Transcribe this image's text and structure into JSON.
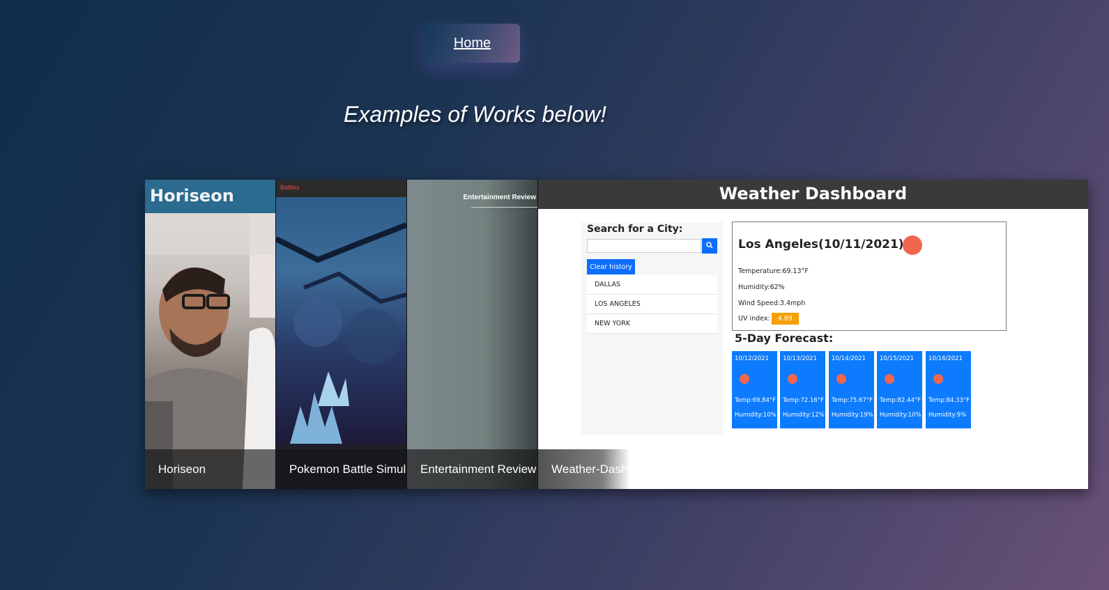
{
  "nav": {
    "home_label": "Home"
  },
  "headline": "Examples of Works below!",
  "works": [
    {
      "caption": "Horiseon",
      "brand": "Horiseon"
    },
    {
      "caption": "Pokemon Battle Simulat",
      "brand": "Battles"
    },
    {
      "caption": "Entertainment Review",
      "nav_title": "Entertainment Review"
    },
    {
      "caption": "Weather-Dashb"
    }
  ],
  "weather": {
    "title": "Weather Dashboard",
    "search_label": "Search for a City:",
    "search_placeholder": "",
    "clear_label": "Clear history",
    "history": [
      "DALLAS",
      "LOS ANGELES",
      "NEW YORK"
    ],
    "current": {
      "city": "Los Angeles(10/11/2021)",
      "temperature": "Temperature:69.13°F",
      "humidity": "Humidity:62%",
      "wind": "Wind Speed:3.4mph",
      "uv_label": "UV index:",
      "uv_value": "4.89"
    },
    "forecast_title": "5-Day Forecast:",
    "forecast": [
      {
        "date": "10/12/2021",
        "temp": "Temp:69.84°F",
        "humidity": "Humidity:10%"
      },
      {
        "date": "10/13/2021",
        "temp": "Temp:72.16°F",
        "humidity": "Humidity:12%"
      },
      {
        "date": "10/14/2021",
        "temp": "Temp:75.67°F",
        "humidity": "Humidity:19%"
      },
      {
        "date": "10/15/2021",
        "temp": "Temp:82.44°F",
        "humidity": "Humidity:10%"
      },
      {
        "date": "10/16/2021",
        "temp": "Temp:84.33°F",
        "humidity": "Humidity:9%"
      }
    ]
  },
  "colors": {
    "accent": "#0d7bfd",
    "uv": "#f5a003",
    "sun_icon": "#f0674e",
    "header": "#3a3a3a"
  }
}
